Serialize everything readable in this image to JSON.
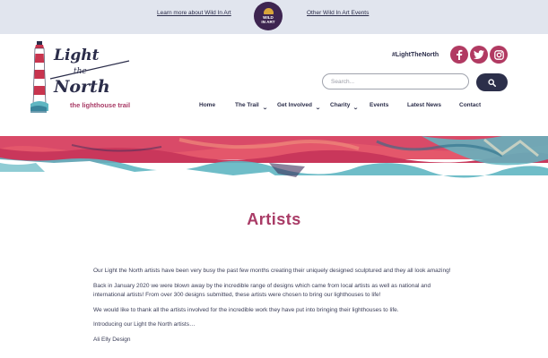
{
  "topbar": {
    "left_link": "Learn more about Wild In Art",
    "right_link": "Other Wild In Art Events",
    "logo_line1": "WILD",
    "logo_line2": "IN ART"
  },
  "brand": {
    "title_line1": "Light",
    "title_line2": "the",
    "title_line3": "North",
    "tagline": "the lighthouse trail"
  },
  "header": {
    "hashtag": "#LightTheNorth",
    "social": [
      "facebook-icon",
      "twitter-icon",
      "instagram-icon"
    ],
    "search_placeholder": "Search..."
  },
  "nav": {
    "items": [
      {
        "label": "Home",
        "has_dropdown": false
      },
      {
        "label": "The Trail",
        "has_dropdown": true
      },
      {
        "label": "Get Involved",
        "has_dropdown": true
      },
      {
        "label": "Charity",
        "has_dropdown": true
      },
      {
        "label": "Events",
        "has_dropdown": false
      },
      {
        "label": "Latest News",
        "has_dropdown": false
      },
      {
        "label": "Contact",
        "has_dropdown": false
      }
    ]
  },
  "page": {
    "title": "Artists",
    "paragraphs": [
      "Our Light the North artists have been very busy the past few months creating their uniquely designed sculptured and they all look amazing!",
      "Back in January 2020 we were blown away by the incredible range of designs which came from local artists as well as national and international artists!  From over 300 designs submitted, these artists were chosen to bring our lighthouses to life!",
      "We would like to thank all the artists involved for the incredible work they have put into bringing their lighthouses to life.",
      "Introducing our Light the North artists…",
      "Ali Elly Design"
    ]
  },
  "colors": {
    "brand_pink": "#a93b66",
    "navy": "#2b2d4a",
    "topbar_bg": "#e1e5ee",
    "banner_teal": "#5fb6c2",
    "banner_coral": "#e4576b"
  }
}
